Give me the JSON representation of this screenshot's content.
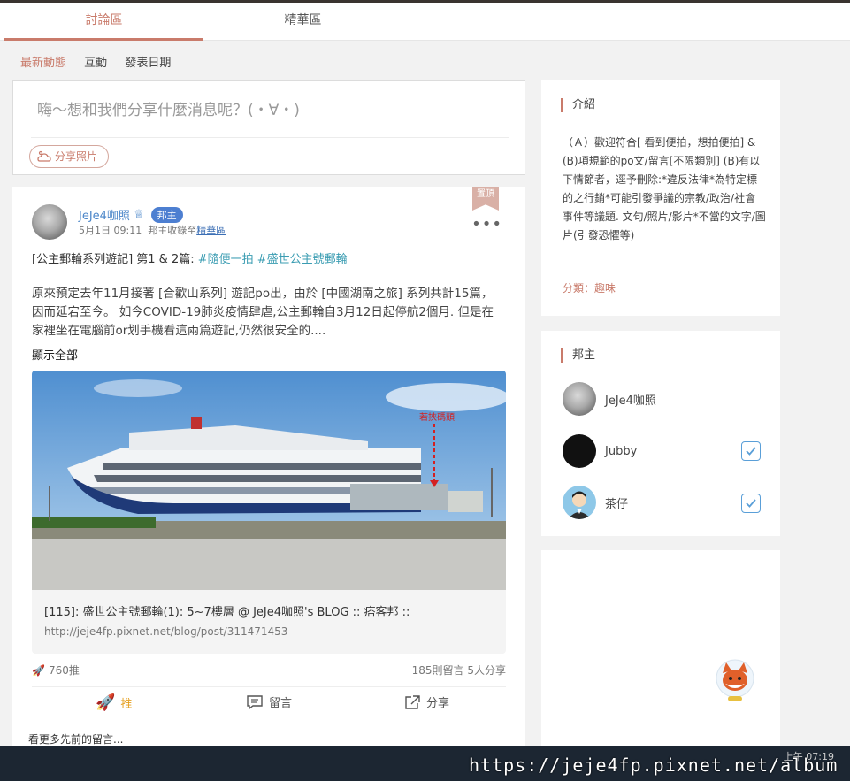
{
  "tabs": [
    {
      "label": "討論區",
      "active": true
    },
    {
      "label": "精華區",
      "active": false
    }
  ],
  "filters": [
    {
      "label": "最新動態",
      "active": true
    },
    {
      "label": "互動",
      "active": false
    },
    {
      "label": "發表日期",
      "active": false
    }
  ],
  "composer": {
    "placeholder": "嗨～想和我們分享什麼消息呢？(・∀・)",
    "share_photo": "分享照片"
  },
  "post": {
    "pinned_label": "置頂",
    "author": "JeJe4咖照",
    "role_badge": "邦主",
    "date": "5月1日 09:11",
    "collected_prefix": "邦主收錄至",
    "collected_link": "精華區",
    "title_text": "[公主郵輪系列遊記] 第1 & 2篇: ",
    "tag1": "#隨便一拍",
    "tag2": "#盛世公主號郵輪",
    "body": "原來預定去年11月接著 [合歡山系列] 遊記po出，由於 [中國湖南之旅] 系列共計15篇，因而延宕至今。 如今COVID-19肺炎疫情肆虐,公主郵輪自3月12日起停航2個月. 但是在家裡坐在電腦前or划手機看這兩篇遊記,仍然很安全的....",
    "show_all": "顯示全部",
    "photo_annotation": "若挾碼頭",
    "link_title": "[115]: 盛世公主號郵輪(1): 5~7樓層 @ JeJe4咖照's BLOG :: 痞客邦 ::",
    "link_url": "http://jeje4fp.pixnet.net/blog/post/311471453",
    "push_count": "760推",
    "comments_shares": "185則留言  5人分享",
    "action_push": "推",
    "action_comment": "留言",
    "action_share": "分享",
    "see_more": "看更多先前的留言..."
  },
  "sidebar": {
    "intro_title": "介紹",
    "intro_text": "（Ａ）歡迎符合[ 看到便拍，想拍便拍] & (B)項規範的po文/留言[不限類別] (B)有以下情節者，逕予刪除:*違反法律*為特定標的之行銷*可能引發爭議的宗教/政治/社會事件等議題. 文句/照片/影片*不當的文字/圖片(引發恐懼等)",
    "category": "分類：趣味",
    "mods_title": "邦主",
    "mods": [
      {
        "name": "JeJe4咖照",
        "checked": false
      },
      {
        "name": "Jubby",
        "checked": true
      },
      {
        "name": "茶仔",
        "checked": true
      }
    ]
  },
  "taskbar": {
    "time": "上午 07:19"
  },
  "watermark": "https://jeje4fp.pixnet.net/album",
  "colors": {
    "accent": "#c97b6b",
    "link": "#4b86c9",
    "tag": "#3a9cb2",
    "push": "#e5a020"
  }
}
